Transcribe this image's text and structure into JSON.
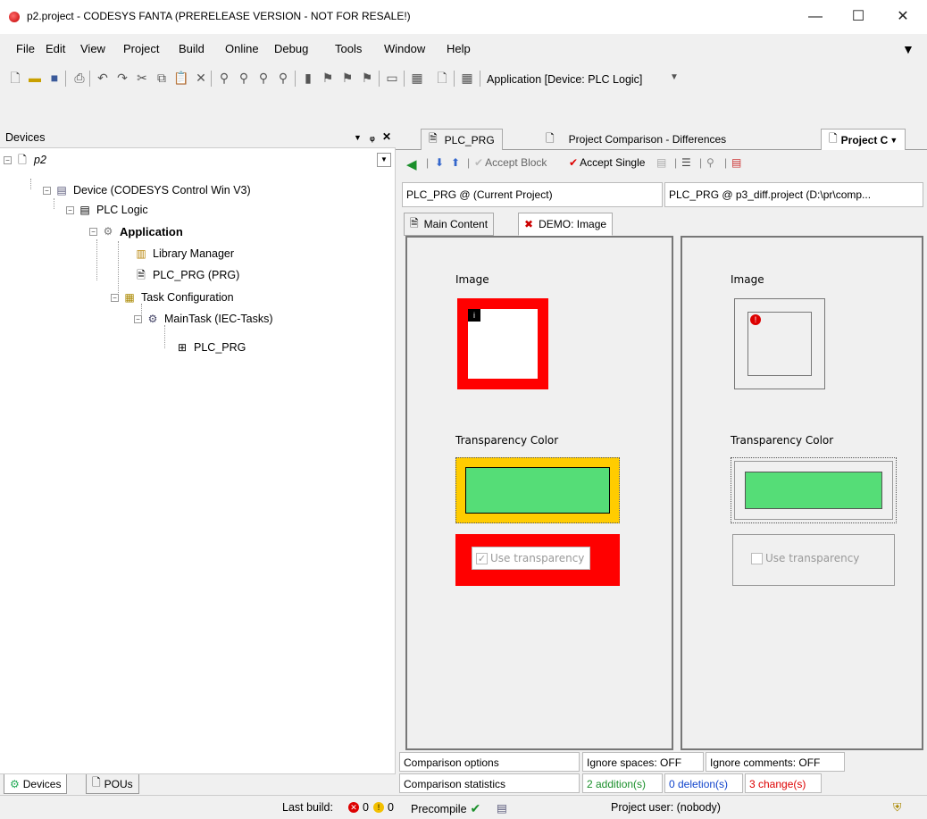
{
  "window": {
    "title": "p2.project - CODESYS FANTA (PRERELEASE VERSION - NOT FOR RESALE!)",
    "min": "—",
    "max": "☐",
    "close": "✕"
  },
  "menu": [
    "File",
    "Edit",
    "View",
    "Project",
    "Build",
    "Online",
    "Debug",
    "Tools",
    "Window",
    "Help"
  ],
  "toolbar": {
    "app_selector": "Application [Device: PLC Logic]"
  },
  "devices": {
    "header": "Devices",
    "tree": {
      "root": "p2",
      "device": "Device (CODESYS Control Win V3)",
      "plc_logic": "PLC Logic",
      "application": "Application",
      "library_manager": "Library Manager",
      "plc_prg": "PLC_PRG (PRG)",
      "task_config": "Task Configuration",
      "maintask": "MainTask (IEC-Tasks)",
      "task_plc_prg": "PLC_PRG"
    },
    "bottom_tabs": [
      "Devices",
      "POUs"
    ]
  },
  "editor": {
    "tabs": [
      "PLC_PRG",
      "Project Comparison - Differences",
      "Project C"
    ],
    "compare_toolbar": {
      "accept_block": "Accept Block",
      "accept_single": "Accept Single"
    },
    "left_path": "PLC_PRG @ (Current Project)",
    "right_path": "PLC_PRG @ p3_diff.project (D:\\pr\\comp...",
    "subtabs": [
      "Main Content",
      "DEMO: Image"
    ],
    "left": {
      "image_label": "Image",
      "transparency_label": "Transparency Color",
      "use_transparency": "Use transparency"
    },
    "right": {
      "image_label": "Image",
      "transparency_label": "Transparency Color",
      "use_transparency": "Use transparency"
    },
    "colors": {
      "changed": "#ff0000",
      "color_changed": "#ffcc00",
      "green": "#55dd77"
    }
  },
  "comparison": {
    "options_label": "Comparison options",
    "ignore_spaces": "Ignore spaces: OFF",
    "ignore_comments": "Ignore comments: OFF",
    "stats_label": "Comparison statistics",
    "additions": "2 addition(s)",
    "deletions": "0 deletion(s)",
    "changes": "3 change(s)"
  },
  "statusbar": {
    "last_build": "Last build:",
    "errors": "0",
    "warnings": "0",
    "precompile": "Precompile",
    "user": "Project user: (nobody)"
  }
}
